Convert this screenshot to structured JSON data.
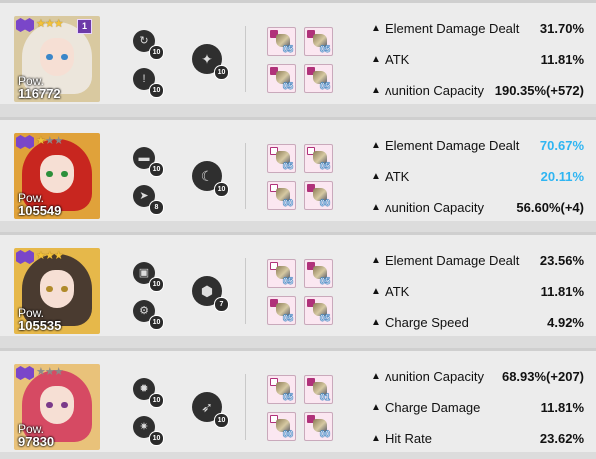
{
  "characters": [
    {
      "pow_label": "Pow.",
      "pow": "116772",
      "stars": 3,
      "rank": "1",
      "has_rank": true,
      "skill1_level": "10",
      "skill2_level": "10",
      "burst_level": "10",
      "skill_icons": [
        "clock-arrow-icon",
        "alert-circle-icon",
        "beast-emblem-icon"
      ],
      "gear_levels": [
        "05",
        "05",
        "05",
        "05"
      ],
      "gear_tags": [
        "pink",
        "pink",
        "pink",
        "pink"
      ],
      "stats": [
        {
          "name": "Element Damage Dealt",
          "value": "31.70%",
          "highlight": false
        },
        {
          "name": "ATK",
          "value": "11.81%",
          "highlight": false
        },
        {
          "name": "ʌunition Capacity",
          "value": "190.35%(+572)",
          "highlight": false
        }
      ],
      "colors": {
        "bg": "#d9c9a0",
        "hair": "#ece6dc",
        "eye": "#3a86c9"
      }
    },
    {
      "pow_label": "Pow.",
      "pow": "105549",
      "stars": 1,
      "rank": "",
      "has_rank": false,
      "skill1_level": "10",
      "skill2_level": "8",
      "burst_level": "10",
      "skill_icons": [
        "gun-icon",
        "arrow-strike-icon",
        "wolf-emblem-icon"
      ],
      "gear_levels": [
        "05",
        "05",
        "00",
        "00"
      ],
      "gear_tags": [
        "white",
        "white",
        "white",
        "pink"
      ],
      "stats": [
        {
          "name": "Element Damage Dealt",
          "value": "70.67%",
          "highlight": true
        },
        {
          "name": "ATK",
          "value": "20.11%",
          "highlight": true
        },
        {
          "name": "ʌunition Capacity",
          "value": "56.60%(+4)",
          "highlight": false
        }
      ],
      "colors": {
        "bg": "#e0a23a",
        "hair": "#c8261f",
        "eye": "#2c8f3a"
      }
    },
    {
      "pow_label": "Pow.",
      "pow": "105535",
      "stars": 3,
      "rank": "",
      "has_rank": false,
      "skill1_level": "10",
      "skill2_level": "10",
      "burst_level": "7",
      "skill_icons": [
        "box-icon",
        "gears-icon",
        "shield-emblem-icon"
      ],
      "gear_levels": [
        "05",
        "05",
        "05",
        "05"
      ],
      "gear_tags": [
        "white",
        "pink",
        "pink",
        "pink"
      ],
      "stats": [
        {
          "name": "Element Damage Dealt",
          "value": "23.56%",
          "highlight": false
        },
        {
          "name": "ATK",
          "value": "11.81%",
          "highlight": false
        },
        {
          "name": "Charge Speed",
          "value": "4.92%",
          "highlight": false
        }
      ],
      "colors": {
        "bg": "#e6b84a",
        "hair": "#4a3b30",
        "eye": "#b08a2a"
      }
    },
    {
      "pow_label": "Pow.",
      "pow": "97830",
      "stars": 0,
      "rank": "",
      "has_rank": false,
      "skill1_level": "10",
      "skill2_level": "10",
      "burst_level": "10",
      "skill_icons": [
        "burst-icon",
        "spark-icon",
        "bird-emblem-icon"
      ],
      "gear_levels": [
        "05",
        "01",
        "00",
        "00"
      ],
      "gear_tags": [
        "white",
        "pink",
        "white",
        "pink"
      ],
      "stats": [
        {
          "name": "ʌunition Capacity",
          "value": "68.93%(+207)",
          "highlight": false
        },
        {
          "name": "Charge Damage",
          "value": "11.81%",
          "highlight": false
        },
        {
          "name": "Hit Rate",
          "value": "23.62%",
          "highlight": false
        }
      ],
      "colors": {
        "bg": "#e9c27a",
        "hair": "#d64a63",
        "eye": "#7a3a8a"
      }
    }
  ],
  "icons": {
    "stat_bullet": "▲",
    "star": "★"
  }
}
